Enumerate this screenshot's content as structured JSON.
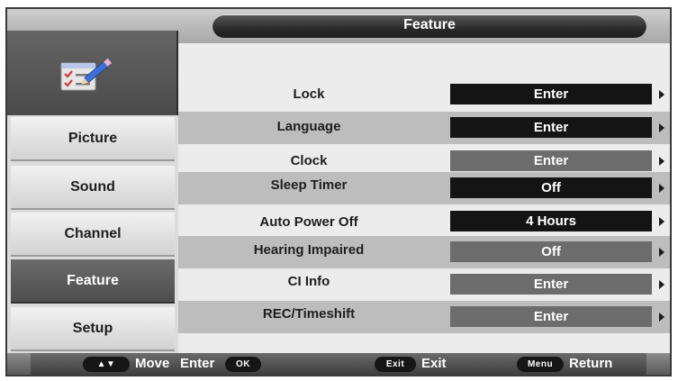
{
  "header": {
    "title": "Feature"
  },
  "sidebar": {
    "icon": "checklist-pencil-icon",
    "items": [
      {
        "label": "Picture",
        "active": false
      },
      {
        "label": "Sound",
        "active": false
      },
      {
        "label": "Channel",
        "active": false
      },
      {
        "label": "Feature",
        "active": true
      },
      {
        "label": "Setup",
        "active": false
      }
    ]
  },
  "menu": {
    "rows": [
      {
        "label": "Lock",
        "value": "Enter",
        "value_style": "dark",
        "shaded": false
      },
      {
        "label": "Language",
        "value": "Enter",
        "value_style": "dark",
        "shaded": true
      },
      {
        "label": "Clock",
        "value": "Enter",
        "value_style": "grey",
        "shaded": false
      },
      {
        "label": "Sleep Timer",
        "value": "Off",
        "value_style": "dark",
        "shaded": true
      },
      {
        "label": "Auto Power Off",
        "value": "4 Hours",
        "value_style": "dark",
        "shaded": false
      },
      {
        "label": "Hearing Impaired",
        "value": "Off",
        "value_style": "grey",
        "shaded": true
      },
      {
        "label": "CI Info",
        "value": "Enter",
        "value_style": "grey",
        "shaded": false
      },
      {
        "label": "REC/Timeshift",
        "value": "Enter",
        "value_style": "grey",
        "shaded": true
      }
    ]
  },
  "footer": {
    "nav_key": "▲▼",
    "move_label": "Move",
    "enter_label": "Enter",
    "ok_key": "OK",
    "exit_key": "Exit",
    "exit_label": "Exit",
    "menu_key": "Menu",
    "return_label": "Return"
  },
  "colors": {
    "dark_value": "#141414",
    "grey_value": "#6c6c6c",
    "active_item": "#5a5a5a",
    "shaded_row": "#bdbdbd"
  }
}
